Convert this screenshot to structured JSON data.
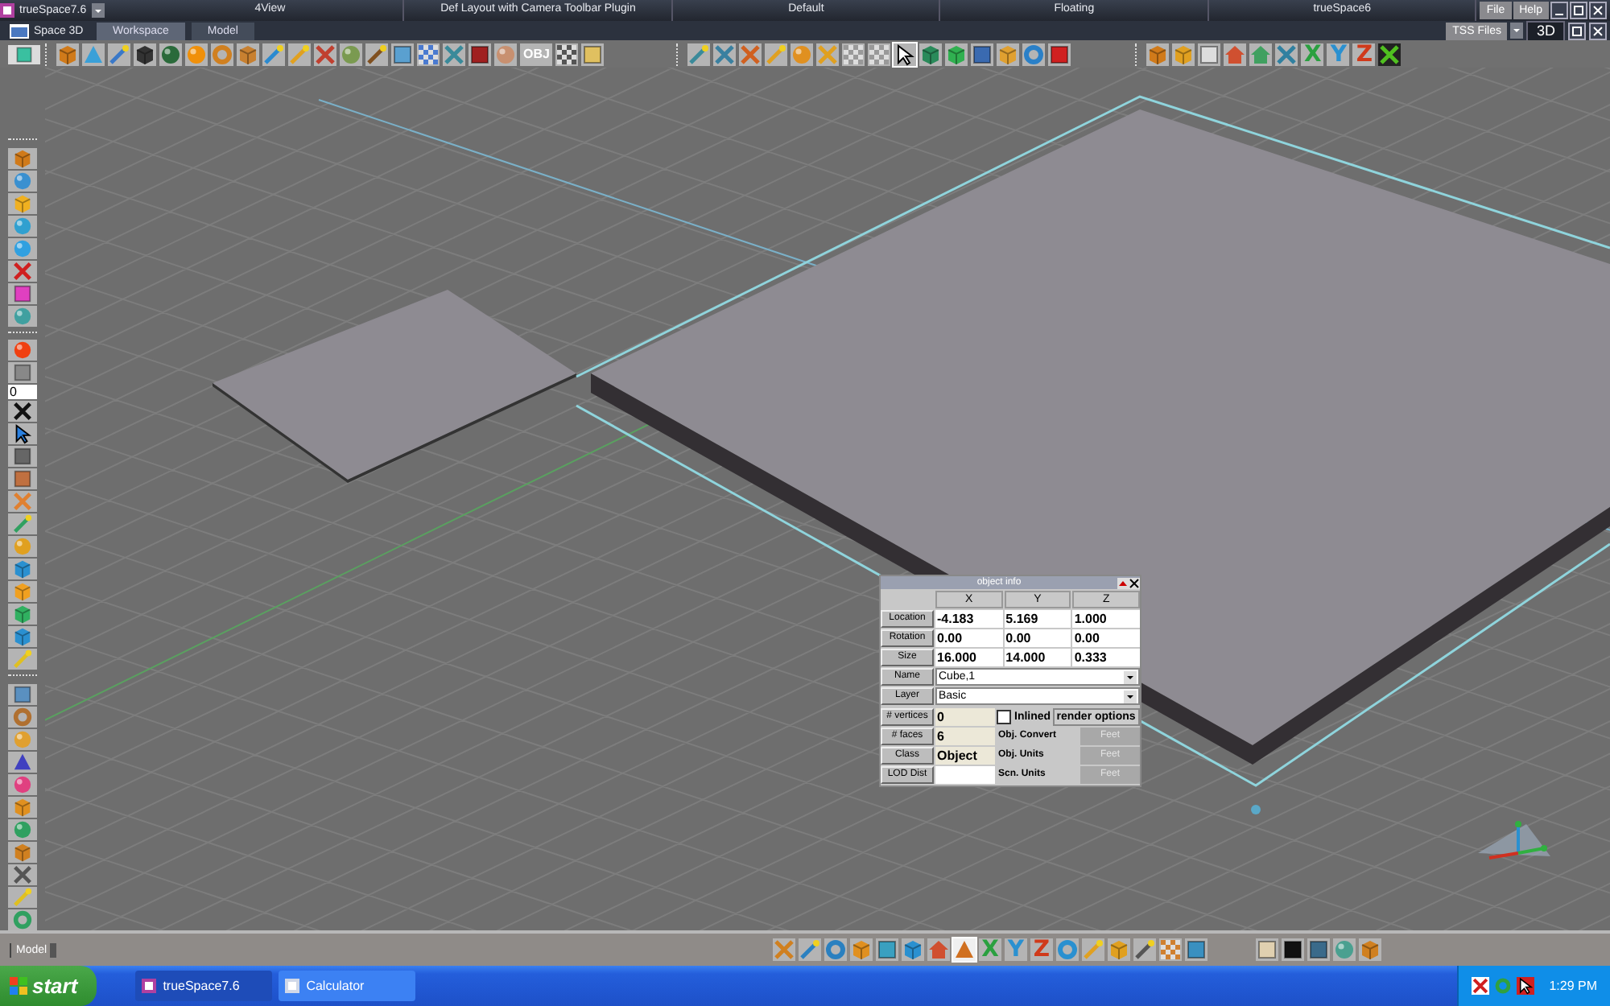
{
  "title_bar": {
    "app": "trueSpace7.6",
    "layouts": [
      {
        "label": "4View",
        "selected": false
      },
      {
        "label": "Def Layout with Camera Toolbar Plugin",
        "selected": false
      },
      {
        "label": "Default",
        "selected": false
      },
      {
        "label": "Floating",
        "selected": false
      },
      {
        "label": "trueSpace6",
        "selected": false
      }
    ],
    "menus": [
      "File",
      "Help"
    ]
  },
  "sub_bar": {
    "space": "Space 3D",
    "tabs": [
      {
        "label": "Workspace",
        "selected": true
      },
      {
        "label": "Model",
        "selected": false
      }
    ],
    "tss_files": "TSS Files",
    "view_mode": "3D"
  },
  "top_toolbar": {
    "obj_button": "OBJ",
    "axis_buttons": [
      "X",
      "Y",
      "Z"
    ]
  },
  "left_toolbar": {
    "frame_field": "0"
  },
  "object_info": {
    "title": "object info",
    "columns": [
      "X",
      "Y",
      "Z"
    ],
    "rows": [
      {
        "label": "Location",
        "values": [
          "-4.183",
          "5.169",
          "1.000"
        ]
      },
      {
        "label": "Rotation",
        "values": [
          "0.00",
          "0.00",
          "0.00"
        ]
      },
      {
        "label": "Size",
        "values": [
          "16.000",
          "14.000",
          "0.333"
        ]
      }
    ],
    "name": {
      "label": "Name",
      "value": "Cube,1"
    },
    "layer": {
      "label": "Layer",
      "value": "Basic"
    },
    "vertices": {
      "label": "# vertices",
      "value": "0"
    },
    "faces": {
      "label": "# faces",
      "value": "6"
    },
    "class": {
      "label": "Class",
      "value": "Object"
    },
    "lod": {
      "label": "LOD Dist"
    },
    "inlined": {
      "label": "Inlined",
      "checked": false
    },
    "render_options": "render options",
    "units": [
      {
        "label": "Obj. Convert",
        "value": "Feet",
        "disabled": true
      },
      {
        "label": "Obj. Units",
        "value": "Feet",
        "disabled": true
      },
      {
        "label": "Scn. Units",
        "value": "Feet",
        "disabled": true
      }
    ]
  },
  "status_bar": {
    "mode": "Model"
  },
  "bottom_toolbar": {
    "axis_buttons": [
      "X",
      "Y",
      "Z"
    ]
  },
  "taskbar": {
    "start": "start",
    "tasks": [
      {
        "label": "trueSpace7.6",
        "selected": true
      },
      {
        "label": "Calculator",
        "selected": false
      }
    ],
    "clock": "1:29 PM"
  }
}
